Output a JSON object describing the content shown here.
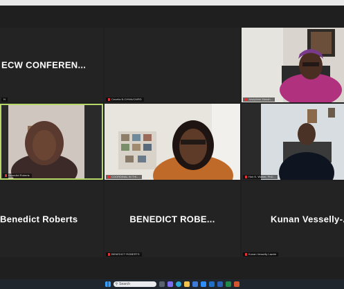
{
  "tiles": [
    {
      "name": "ECW CONFEREN...",
      "label": "N"
    },
    {
      "label": "Cecelia B-CHWA/CMRD"
    },
    {
      "label": "Josephine Manah..."
    },
    {
      "label": "Benedict Roberts"
    },
    {
      "label": "COORDINAL IN THL..."
    },
    {
      "label": "Hon K. Walker, PhD..."
    },
    {
      "name": "Benedict Roberts",
      "label": ""
    },
    {
      "name": "BENEDICT ROBE...",
      "label": "BENEDICT ROBERTS"
    },
    {
      "name": "Kunan Vesselly-...",
      "label": "Kunan Vesselly Lawrie"
    }
  ],
  "taskbar": {
    "search_placeholder": "Search"
  },
  "colors": {
    "active_border": "#b8d86a",
    "background": "#1f1f1f",
    "taskbar": "#20262e"
  }
}
